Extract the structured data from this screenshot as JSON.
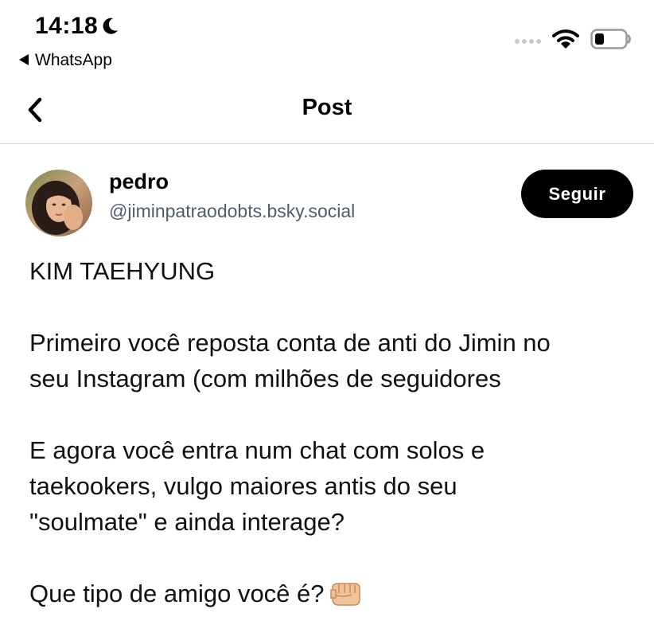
{
  "status_bar": {
    "time": "14:18",
    "back_app_label": "WhatsApp",
    "icons": [
      "moon-icon",
      "signal-dots-icon",
      "wifi-icon",
      "battery-icon"
    ]
  },
  "nav": {
    "title": "Post",
    "back_icon": "chevron-left-icon"
  },
  "post": {
    "author": {
      "name": "pedro",
      "handle": "@jiminpatraodobts.bsky.social"
    },
    "follow_label": "Seguir",
    "paragraphs": [
      [
        "KIM TAEHYUNG"
      ],
      [
        "Primeiro você reposta conta de anti do Jimin no",
        "seu Instagram (com milhões de seguidores"
      ],
      [
        "E agora você entra num chat com solos e",
        "taekookers, vulgo maiores antis do seu",
        "\"soulmate\" e ainda interage?"
      ],
      [
        "Que tipo de amigo você é?"
      ]
    ],
    "trailing_emoji": "fist-pointing-emoji"
  },
  "colors": {
    "background": "#ffffff",
    "text": "#000000",
    "handle": "#4e5d6e",
    "follow_button_bg": "#000000",
    "follow_button_text": "#ffffff",
    "divider": "#dcdfe3",
    "emoji_skin": "#f1c39a"
  }
}
